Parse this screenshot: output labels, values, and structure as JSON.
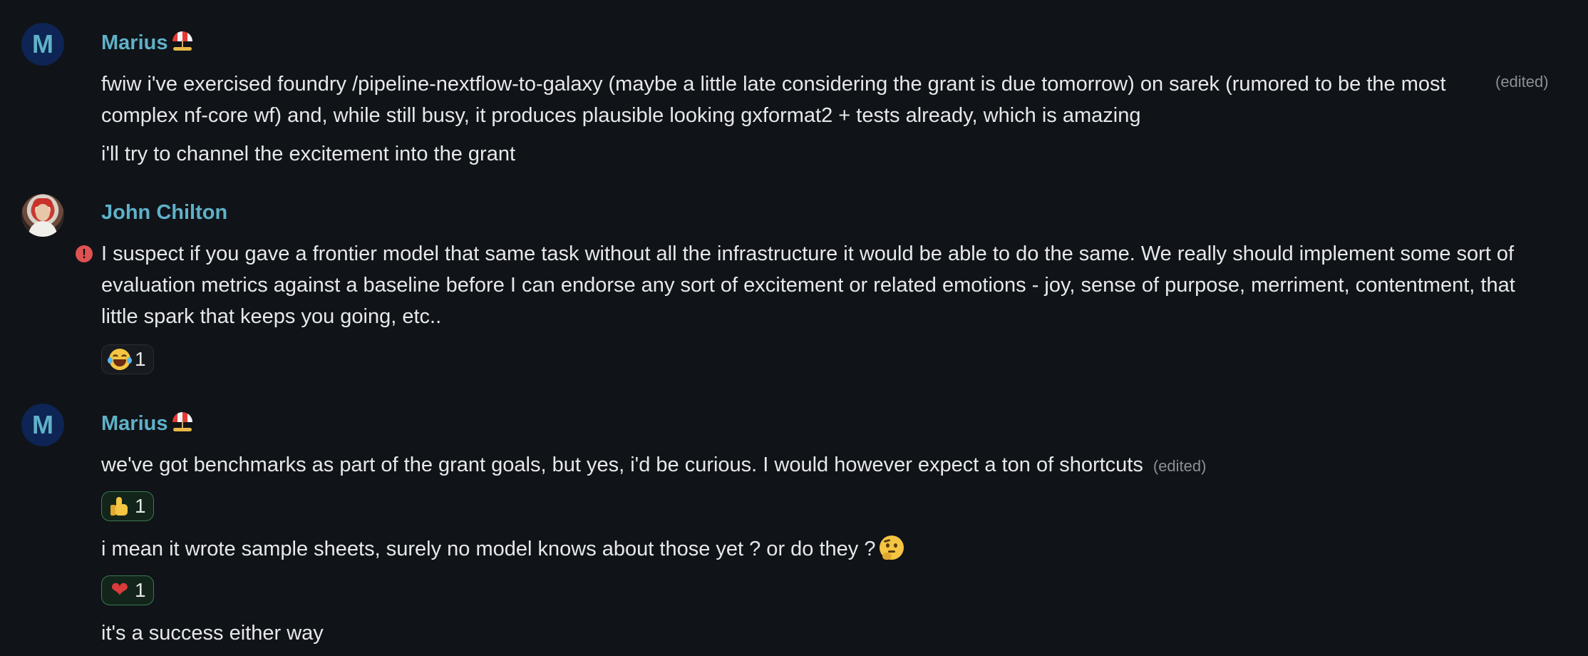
{
  "messages": [
    {
      "sender": "Marius",
      "avatar_letter": "M",
      "status_emoji": "beach-umbrella-icon",
      "paragraphs": [
        "fwiw i've exercised foundry /pipeline-nextflow-to-galaxy (maybe a little late considering the grant is due tomorrow) on sarek (rumored to be the most complex nf-core wf) and, while still busy, it produces plausible looking gxformat2 + tests already, which is amazing",
        "i'll try to channel the excitement into the grant"
      ],
      "edited_label": "(edited)"
    },
    {
      "sender": "John Chilton",
      "avatar": "photo-avatar",
      "error_icon": "!",
      "paragraphs": [
        "I suspect if you gave a frontier model that same task without all the infrastructure it would be able to do the same. We really should implement some sort of evaluation metrics against a baseline before I can endorse any sort of excitement or related emotions - joy, sense of purpose, merriment, contentment, that little spark that keeps you going, etc.."
      ],
      "reactions": [
        {
          "emoji": "laughing-tears-emoji",
          "count": "1"
        }
      ]
    },
    {
      "sender": "Marius",
      "avatar_letter": "M",
      "status_emoji": "beach-umbrella-icon",
      "paragraphs": [
        "we've got benchmarks as part of the grant goals, but yes, i'd be curious. I would however expect a ton of shortcuts",
        "i mean it wrote sample sheets, surely no model knows about those yet ? or do they ?",
        "it's a success either way"
      ],
      "edited_label": "(edited)",
      "reactions": [
        {
          "emoji": "thumbs-up-emoji",
          "count": "1"
        },
        {
          "emoji": "red-heart-emoji",
          "heart_glyph": "❤",
          "count": "1"
        }
      ]
    }
  ],
  "colors": {
    "background": "#101318",
    "sender_name": "#5fb1c8",
    "text": "#e6e8ea",
    "muted": "#8a9097",
    "avatar_bg": "#0d2454",
    "reaction_own_border": "#3c7a4e",
    "error": "#e05252"
  }
}
